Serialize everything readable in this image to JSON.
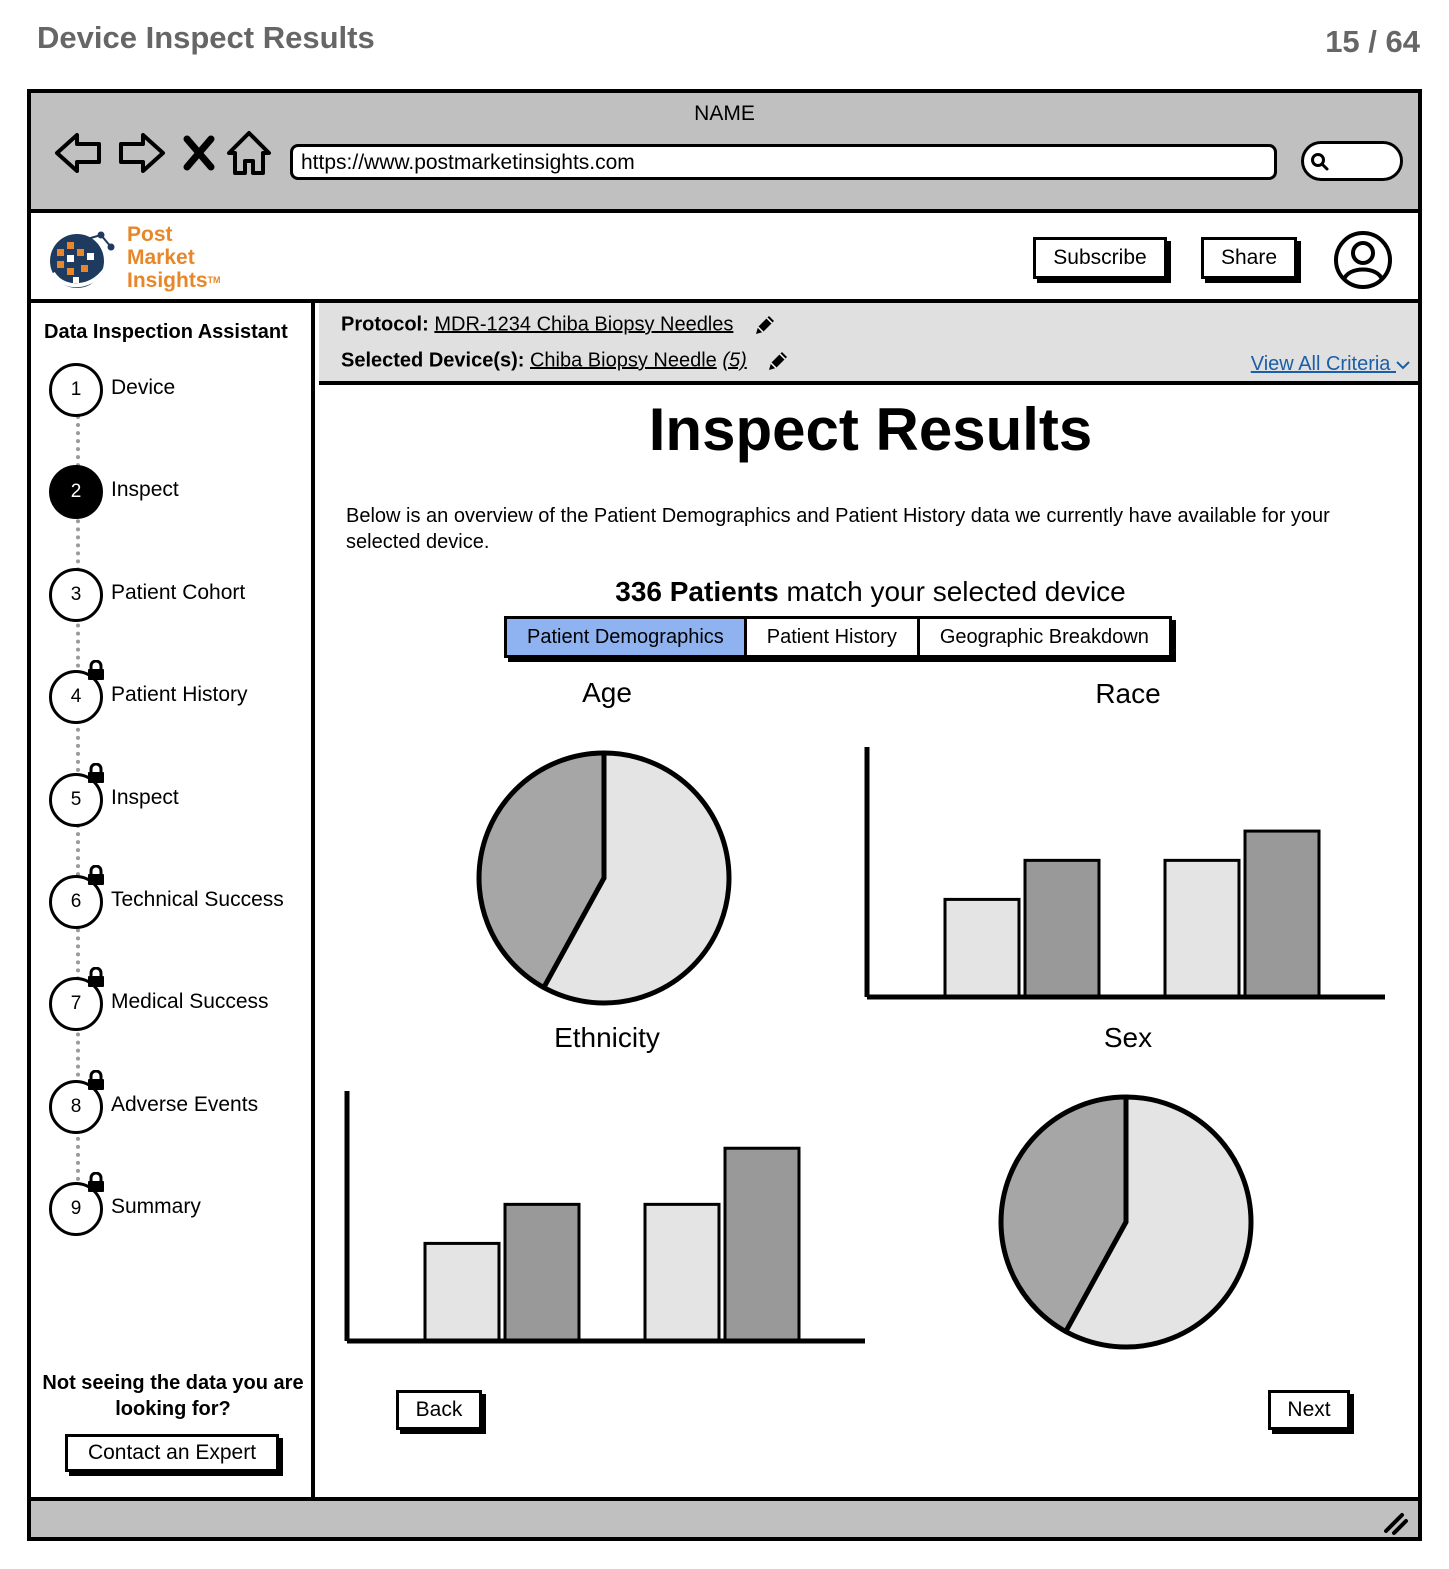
{
  "page": {
    "title": "Device Inspect Results",
    "page_counter": "15 / 64"
  },
  "browser": {
    "window_name": "NAME",
    "url": "https://www.postmarketinsights.com"
  },
  "header": {
    "brand_line1": "Post",
    "brand_line2": "Market",
    "brand_line3": "Insights",
    "brand_tm": "TM",
    "subscribe_label": "Subscribe",
    "share_label": "Share"
  },
  "sidebar": {
    "title": "Data Inspection Assistant",
    "steps": [
      {
        "num": "1",
        "label": "Device",
        "state": "done",
        "locked": false
      },
      {
        "num": "2",
        "label": "Inspect",
        "state": "active",
        "locked": false
      },
      {
        "num": "3",
        "label": "Patient Cohort",
        "state": "todo",
        "locked": false
      },
      {
        "num": "4",
        "label": "Patient History",
        "state": "todo",
        "locked": true
      },
      {
        "num": "5",
        "label": "Inspect",
        "state": "todo",
        "locked": true
      },
      {
        "num": "6",
        "label": "Technical Success",
        "state": "todo",
        "locked": true
      },
      {
        "num": "7",
        "label": "Medical Success",
        "state": "todo",
        "locked": true
      },
      {
        "num": "8",
        "label": "Adverse Events",
        "state": "todo",
        "locked": true
      },
      {
        "num": "9",
        "label": "Summary",
        "state": "todo",
        "locked": true
      }
    ],
    "help_text": "Not seeing the data you are looking for?",
    "contact_label": "Contact an Expert"
  },
  "info": {
    "protocol_label": "Protocol:",
    "protocol_value": "MDR-1234 Chiba Biopsy Needles",
    "device_label": "Selected Device(s):",
    "device_value": "Chiba Biopsy Needle",
    "device_count": "(5)",
    "view_all_label": "View All Criteria"
  },
  "main": {
    "title": "Inspect Results",
    "description": "Below is an overview of the Patient Demographics and Patient History data we currently have available for your selected device.",
    "match_count": "336 Patients",
    "match_suffix": " match your selected device",
    "tabs": [
      {
        "label": "Patient Demographics",
        "active": true
      },
      {
        "label": "Patient History",
        "active": false
      },
      {
        "label": "Geographic Breakdown",
        "active": false
      }
    ],
    "back_label": "Back",
    "next_label": "Next"
  },
  "colors": {
    "accent": "#8fb3f0",
    "brand": "#e8872a",
    "link": "#1a5ea8",
    "chrome": "#c0c0c0",
    "light_fill": "#e4e4e4",
    "mid_fill": "#a6a6a6",
    "dark_fill": "#999999"
  },
  "chart_data": [
    {
      "type": "pie",
      "title": "Age",
      "values": [
        58,
        42
      ],
      "colors": [
        "#e4e4e4",
        "#a6a6a6"
      ]
    },
    {
      "type": "bar",
      "title": "Race",
      "categories": [
        "",
        ""
      ],
      "series": [
        {
          "values": [
            40,
            56
          ],
          "color": "#e4e4e4"
        },
        {
          "values": [
            56,
            68
          ],
          "color": "#999999"
        }
      ],
      "ylim": [
        0,
        100
      ]
    },
    {
      "type": "bar",
      "title": "Ethnicity",
      "categories": [
        "",
        ""
      ],
      "series": [
        {
          "values": [
            40,
            56
          ],
          "color": "#e4e4e4"
        },
        {
          "values": [
            56,
            79
          ],
          "color": "#999999"
        }
      ],
      "ylim": [
        0,
        100
      ]
    },
    {
      "type": "pie",
      "title": "Sex",
      "values": [
        58,
        42
      ],
      "colors": [
        "#e4e4e4",
        "#a6a6a6"
      ]
    }
  ]
}
